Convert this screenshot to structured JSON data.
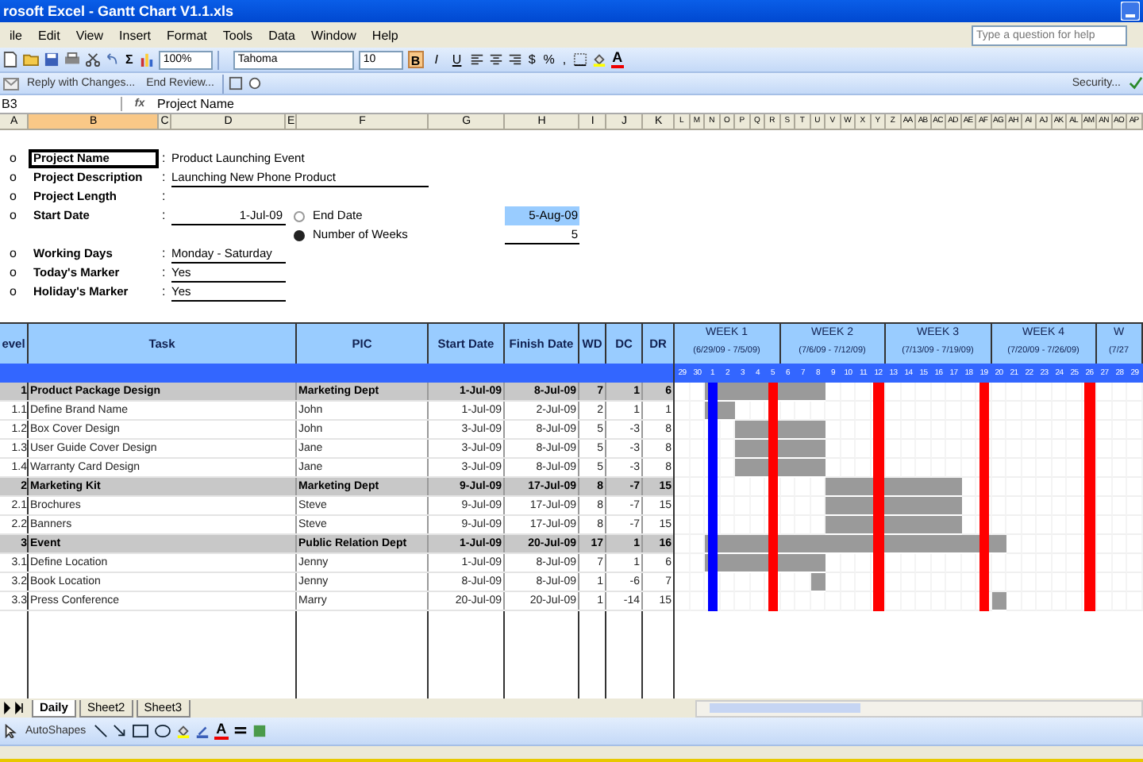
{
  "window": {
    "title": "rosoft Excel - Gantt Chart V1.1.xls"
  },
  "menu": [
    "ile",
    "Edit",
    "View",
    "Insert",
    "Format",
    "Tools",
    "Data",
    "Window",
    "Help"
  ],
  "help_box": {
    "placeholder": "Type a question for help"
  },
  "standard_toolbar": {
    "sum": "Σ",
    "zoom": "100%"
  },
  "format_toolbar": {
    "font": "Tahoma",
    "size": "10",
    "styles": [
      {
        "label": "B",
        "selected": true
      },
      {
        "label": "I",
        "selected": false
      },
      {
        "label": "U",
        "selected": false
      }
    ],
    "number_formats": [
      "$",
      "%",
      ","
    ],
    "font_color": "A"
  },
  "review_toolbar": {
    "buttons": [
      "Reply with Changes...",
      "End Review..."
    ],
    "security": "Security..."
  },
  "formula_bar": {
    "name_box": "B3",
    "fx": "fx",
    "content": "Project Name"
  },
  "columns": [
    {
      "label": "A",
      "selected": false
    },
    {
      "label": "B",
      "selected": true
    },
    {
      "label": "C",
      "selected": false
    },
    {
      "label": "D",
      "selected": false
    },
    {
      "label": "E",
      "selected": false
    },
    {
      "label": "F",
      "selected": false
    },
    {
      "label": "G",
      "selected": false
    },
    {
      "label": "H",
      "selected": false
    },
    {
      "label": "I",
      "selected": false
    },
    {
      "label": "J",
      "selected": false
    },
    {
      "label": "K",
      "selected": false
    },
    {
      "label": "L",
      "selected": false
    },
    {
      "label": "M",
      "selected": false
    },
    {
      "label": "N",
      "selected": false
    },
    {
      "label": "O",
      "selected": false
    },
    {
      "label": "P",
      "selected": false
    },
    {
      "label": "Q",
      "selected": false
    },
    {
      "label": "R",
      "selected": false
    },
    {
      "label": "S",
      "selected": false
    },
    {
      "label": "T",
      "selected": false
    },
    {
      "label": "U",
      "selected": false
    },
    {
      "label": "V",
      "selected": false
    },
    {
      "label": "W",
      "selected": false
    },
    {
      "label": "X",
      "selected": false
    },
    {
      "label": "Y",
      "selected": false
    },
    {
      "label": "Z",
      "selected": false
    },
    {
      "label": "AA",
      "selected": false
    },
    {
      "label": "AB",
      "selected": false
    },
    {
      "label": "AC",
      "selected": false
    },
    {
      "label": "AD",
      "selected": false
    },
    {
      "label": "AE",
      "selected": false
    },
    {
      "label": "AF",
      "selected": false
    },
    {
      "label": "AG",
      "selected": false
    },
    {
      "label": "AH",
      "selected": false
    },
    {
      "label": "AI",
      "selected": false
    },
    {
      "label": "AJ",
      "selected": false
    },
    {
      "label": "AK",
      "selected": false
    },
    {
      "label": "AL",
      "selected": false
    },
    {
      "label": "AM",
      "selected": false
    },
    {
      "label": "AN",
      "selected": false
    },
    {
      "label": "AO",
      "selected": false
    },
    {
      "label": "AP",
      "selected": false
    }
  ],
  "project_fields": [
    {
      "marker": "o",
      "label": "Project Name",
      "separator": ":",
      "value": "Product Launching Event",
      "kind": "plain",
      "selected": true
    },
    {
      "marker": "o",
      "label": "Project Description",
      "separator": ":",
      "value": "Launching New Phone Product",
      "kind": "wide",
      "selected": false
    },
    {
      "marker": "o",
      "label": "Project Length",
      "separator": ":",
      "selected": false
    },
    {
      "marker": "o",
      "label": "Start Date",
      "separator": ":",
      "value": "1-Jul-09",
      "kind": "date",
      "selected": false
    }
  ],
  "end_options": [
    {
      "label": "End Date",
      "selected": false,
      "value": "5-Aug-09",
      "kind": "result"
    },
    {
      "label": "Number of Weeks",
      "selected": true,
      "value": "5",
      "kind": "input"
    }
  ],
  "settings_fields": [
    {
      "marker": "o",
      "label": "Working Days",
      "separator": ":",
      "value": "Monday - Saturday",
      "kind": "short",
      "selected": false
    },
    {
      "marker": "o",
      "label": "Today's Marker",
      "separator": ":",
      "value": "Yes",
      "kind": "short",
      "selected": false
    },
    {
      "marker": "o",
      "label": "Holiday's Marker",
      "separator": ":",
      "value": "Yes",
      "kind": "short",
      "selected": false
    }
  ],
  "table": {
    "columns": [
      "evel",
      "Task",
      "PIC",
      "Start Date",
      "Finish Date",
      "WD",
      "DC",
      "DR"
    ],
    "rows": [
      {
        "kind": "summary",
        "level": "1",
        "task": "Product Package Design",
        "pic": "Marketing Dept",
        "start": "1-Jul-09",
        "finish": "8-Jul-09",
        "wd": "7",
        "dc": "1",
        "dr": "6",
        "bar": [
          false,
          false,
          true,
          true,
          true,
          true,
          true,
          true,
          true,
          true,
          false,
          false,
          false,
          false,
          false,
          false,
          false,
          false,
          false,
          false,
          false,
          false,
          false,
          false,
          false,
          false,
          false,
          false,
          false,
          false,
          false
        ]
      },
      {
        "kind": "task",
        "level": "1.1",
        "task": "Define Brand Name",
        "pic": "John",
        "start": "1-Jul-09",
        "finish": "2-Jul-09",
        "wd": "2",
        "dc": "1",
        "dr": "1",
        "bar": [
          false,
          false,
          true,
          true,
          false,
          false,
          false,
          false,
          false,
          false,
          false,
          false,
          false,
          false,
          false,
          false,
          false,
          false,
          false,
          false,
          false,
          false,
          false,
          false,
          false,
          false,
          false,
          false,
          false,
          false,
          false
        ]
      },
      {
        "kind": "task",
        "level": "1.2",
        "task": "Box Cover Design",
        "pic": "John",
        "start": "3-Jul-09",
        "finish": "8-Jul-09",
        "wd": "5",
        "dc": "-3",
        "dr": "8",
        "bar": [
          false,
          false,
          false,
          false,
          true,
          true,
          true,
          true,
          true,
          true,
          false,
          false,
          false,
          false,
          false,
          false,
          false,
          false,
          false,
          false,
          false,
          false,
          false,
          false,
          false,
          false,
          false,
          false,
          false,
          false,
          false
        ]
      },
      {
        "kind": "task",
        "level": "1.3",
        "task": "User Guide Cover Design",
        "pic": "Jane",
        "start": "3-Jul-09",
        "finish": "8-Jul-09",
        "wd": "5",
        "dc": "-3",
        "dr": "8",
        "bar": [
          false,
          false,
          false,
          false,
          true,
          true,
          true,
          true,
          true,
          true,
          false,
          false,
          false,
          false,
          false,
          false,
          false,
          false,
          false,
          false,
          false,
          false,
          false,
          false,
          false,
          false,
          false,
          false,
          false,
          false,
          false
        ]
      },
      {
        "kind": "task",
        "level": "1.4",
        "task": "Warranty Card Design",
        "pic": "Jane",
        "start": "3-Jul-09",
        "finish": "8-Jul-09",
        "wd": "5",
        "dc": "-3",
        "dr": "8",
        "bar": [
          false,
          false,
          false,
          false,
          true,
          true,
          true,
          true,
          true,
          true,
          false,
          false,
          false,
          false,
          false,
          false,
          false,
          false,
          false,
          false,
          false,
          false,
          false,
          false,
          false,
          false,
          false,
          false,
          false,
          false,
          false
        ]
      },
      {
        "kind": "summary",
        "level": "2",
        "task": "Marketing Kit",
        "pic": "Marketing Dept",
        "start": "9-Jul-09",
        "finish": "17-Jul-09",
        "wd": "8",
        "dc": "-7",
        "dr": "15",
        "bar": [
          false,
          false,
          false,
          false,
          false,
          false,
          false,
          false,
          false,
          false,
          true,
          true,
          true,
          true,
          true,
          true,
          true,
          true,
          true,
          false,
          false,
          false,
          false,
          false,
          false,
          false,
          false,
          false,
          false,
          false,
          false
        ]
      },
      {
        "kind": "task",
        "level": "2.1",
        "task": "Brochures",
        "pic": "Steve",
        "start": "9-Jul-09",
        "finish": "17-Jul-09",
        "wd": "8",
        "dc": "-7",
        "dr": "15",
        "bar": [
          false,
          false,
          false,
          false,
          false,
          false,
          false,
          false,
          false,
          false,
          true,
          true,
          true,
          true,
          true,
          true,
          true,
          true,
          true,
          false,
          false,
          false,
          false,
          false,
          false,
          false,
          false,
          false,
          false,
          false,
          false
        ]
      },
      {
        "kind": "task",
        "level": "2.2",
        "task": "Banners",
        "pic": "Steve",
        "start": "9-Jul-09",
        "finish": "17-Jul-09",
        "wd": "8",
        "dc": "-7",
        "dr": "15",
        "bar": [
          false,
          false,
          false,
          false,
          false,
          false,
          false,
          false,
          false,
          false,
          true,
          true,
          true,
          true,
          true,
          true,
          true,
          true,
          true,
          false,
          false,
          false,
          false,
          false,
          false,
          false,
          false,
          false,
          false,
          false,
          false
        ]
      },
      {
        "kind": "summary",
        "level": "3",
        "task": "Event",
        "pic": "Public Relation Dept",
        "start": "1-Jul-09",
        "finish": "20-Jul-09",
        "wd": "17",
        "dc": "1",
        "dr": "16",
        "bar": [
          false,
          false,
          true,
          true,
          true,
          true,
          true,
          true,
          true,
          true,
          true,
          true,
          true,
          true,
          true,
          true,
          true,
          true,
          true,
          true,
          true,
          true,
          false,
          false,
          false,
          false,
          false,
          false,
          false,
          false,
          false
        ]
      },
      {
        "kind": "task",
        "level": "3.1",
        "task": "Define Location",
        "pic": "Jenny",
        "start": "1-Jul-09",
        "finish": "8-Jul-09",
        "wd": "7",
        "dc": "1",
        "dr": "6",
        "bar": [
          false,
          false,
          true,
          true,
          true,
          true,
          true,
          true,
          true,
          true,
          false,
          false,
          false,
          false,
          false,
          false,
          false,
          false,
          false,
          false,
          false,
          false,
          false,
          false,
          false,
          false,
          false,
          false,
          false,
          false,
          false
        ]
      },
      {
        "kind": "task",
        "level": "3.2",
        "task": "Book Location",
        "pic": "Jenny",
        "start": "8-Jul-09",
        "finish": "8-Jul-09",
        "wd": "1",
        "dc": "-6",
        "dr": "7",
        "bar": [
          false,
          false,
          false,
          false,
          false,
          false,
          false,
          false,
          false,
          true,
          false,
          false,
          false,
          false,
          false,
          false,
          false,
          false,
          false,
          false,
          false,
          false,
          false,
          false,
          false,
          false,
          false,
          false,
          false,
          false,
          false
        ]
      },
      {
        "kind": "task",
        "level": "3.3",
        "task": "Press Conference",
        "pic": "Marry",
        "start": "20-Jul-09",
        "finish": "20-Jul-09",
        "wd": "1",
        "dc": "-14",
        "dr": "15",
        "bar": [
          false,
          false,
          false,
          false,
          false,
          false,
          false,
          false,
          false,
          false,
          false,
          false,
          false,
          false,
          false,
          false,
          false,
          false,
          false,
          false,
          false,
          true,
          false,
          false,
          false,
          false,
          false,
          false,
          false,
          false,
          false
        ]
      }
    ]
  },
  "gantt": {
    "weeks": [
      {
        "label": "WEEK 1",
        "range": "(6/29/09 - 7/5/09)",
        "days": [
          {
            "label": "29",
            "today": false,
            "holiday": false
          },
          {
            "label": "30",
            "today": false,
            "holiday": false
          },
          {
            "label": "1",
            "today": true,
            "holiday": false
          },
          {
            "label": "2",
            "today": false,
            "holiday": false
          },
          {
            "label": "3",
            "today": false,
            "holiday": false
          },
          {
            "label": "4",
            "today": false,
            "holiday": false
          },
          {
            "label": "5",
            "today": false,
            "holiday": true
          }
        ]
      },
      {
        "label": "WEEK 2",
        "range": "(7/6/09 - 7/12/09)",
        "days": [
          {
            "label": "6",
            "today": false,
            "holiday": false
          },
          {
            "label": "7",
            "today": false,
            "holiday": false
          },
          {
            "label": "8",
            "today": false,
            "holiday": false
          },
          {
            "label": "9",
            "today": false,
            "holiday": false
          },
          {
            "label": "10",
            "today": false,
            "holiday": false
          },
          {
            "label": "11",
            "today": false,
            "holiday": false
          },
          {
            "label": "12",
            "today": false,
            "holiday": true
          }
        ]
      },
      {
        "label": "WEEK 3",
        "range": "(7/13/09 - 7/19/09)",
        "days": [
          {
            "label": "13",
            "today": false,
            "holiday": false
          },
          {
            "label": "14",
            "today": false,
            "holiday": false
          },
          {
            "label": "15",
            "today": false,
            "holiday": false
          },
          {
            "label": "16",
            "today": false,
            "holiday": false
          },
          {
            "label": "17",
            "today": false,
            "holiday": false
          },
          {
            "label": "18",
            "today": false,
            "holiday": false
          },
          {
            "label": "19",
            "today": false,
            "holiday": true
          }
        ]
      },
      {
        "label": "WEEK 4",
        "range": "(7/20/09 - 7/26/09)",
        "days": [
          {
            "label": "20",
            "today": false,
            "holiday": false
          },
          {
            "label": "21",
            "today": false,
            "holiday": false
          },
          {
            "label": "22",
            "today": false,
            "holiday": false
          },
          {
            "label": "23",
            "today": false,
            "holiday": false
          },
          {
            "label": "24",
            "today": false,
            "holiday": false
          },
          {
            "label": "25",
            "today": false,
            "holiday": false
          },
          {
            "label": "26",
            "today": false,
            "holiday": true
          }
        ]
      },
      {
        "label": "W",
        "range": "(7/27",
        "days": [
          {
            "label": "27",
            "today": false,
            "holiday": false
          },
          {
            "label": "28",
            "today": false,
            "holiday": false
          },
          {
            "label": "29",
            "today": false,
            "holiday": false
          }
        ]
      }
    ]
  },
  "sheet_tabs": [
    {
      "label": "Daily",
      "selected": true
    },
    {
      "label": "Sheet2",
      "selected": false
    },
    {
      "label": "Sheet3",
      "selected": false
    }
  ],
  "drawing_toolbar": {
    "autoshapes": "AutoShapes",
    "font_color": "A"
  }
}
